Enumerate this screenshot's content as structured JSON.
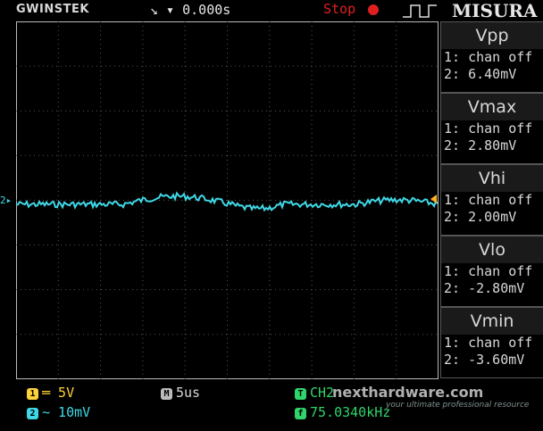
{
  "header": {
    "brand": "GWINSTEK",
    "trigger": "↘ ▾ 0.000s",
    "run_state": "Stop",
    "mode": "MISURA"
  },
  "measurements": [
    {
      "title": "Vpp",
      "ch1": "1: chan off",
      "ch2": "2: 6.40mV"
    },
    {
      "title": "Vmax",
      "ch1": "1: chan off",
      "ch2": "2: 2.80mV"
    },
    {
      "title": "Vhi",
      "ch1": "1: chan off",
      "ch2": "2: 2.00mV"
    },
    {
      "title": "Vlo",
      "ch1": "1: chan off",
      "ch2": "2: -2.80mV"
    },
    {
      "title": "Vmin",
      "ch1": "1: chan off",
      "ch2": "2: -3.60mV"
    }
  ],
  "status": {
    "ch1_badge": "1",
    "ch1_scale": "═ 5V",
    "ch2_badge": "2",
    "ch2_scale": "∼ 10mV",
    "timebase_badge": "M",
    "timebase": "5us",
    "trigger_badge": "T",
    "trigger_source": "CH2",
    "freq_badge": "f",
    "frequency": "75.0340kHz"
  },
  "watermark": {
    "site": "nexthardware.com",
    "tagline": "your ultimate professional resource"
  },
  "colors": {
    "ch1": "#ffd23a",
    "ch2": "#3fd8e6",
    "trigger": "#2fd46a",
    "stop": "#e02020"
  }
}
